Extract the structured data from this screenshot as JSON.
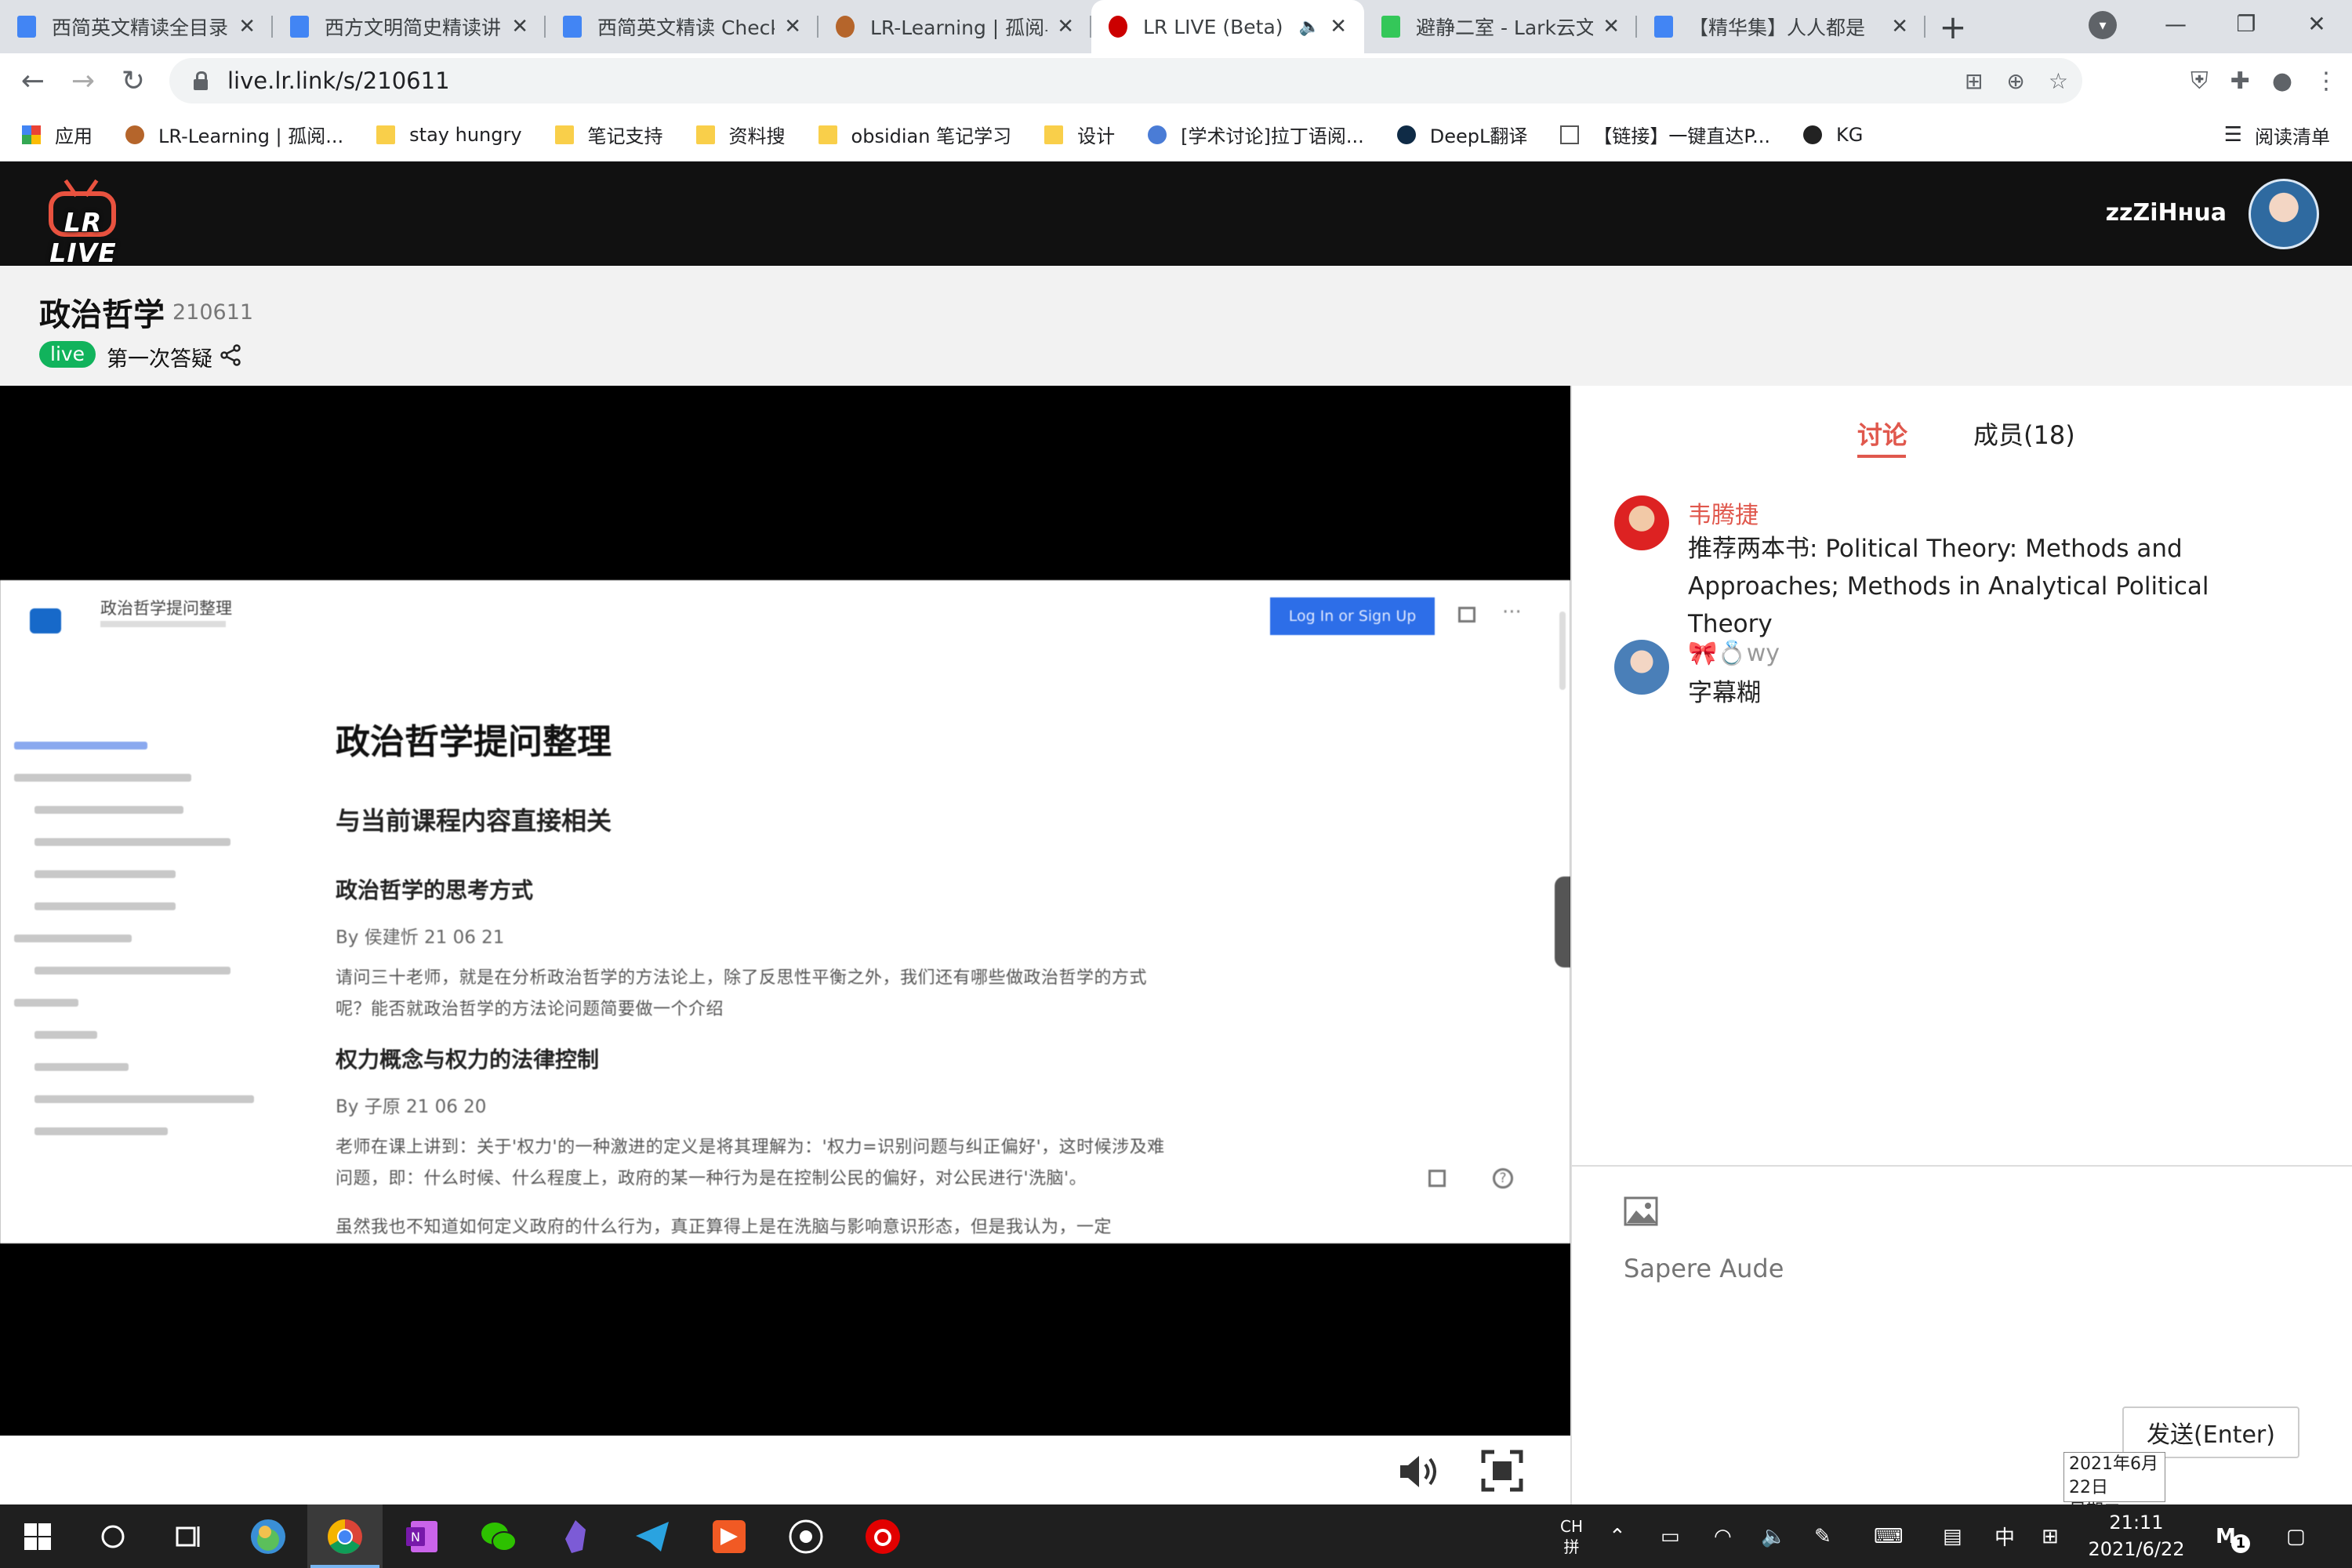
{
  "browser": {
    "tabs": [
      {
        "title": "西简英文精读全目录",
        "icon": "doc",
        "active": false
      },
      {
        "title": "西方文明简史精读讲",
        "icon": "doc",
        "active": false
      },
      {
        "title": "西简英文精读 Check",
        "icon": "doc",
        "active": false
      },
      {
        "title": "LR-Learning | 孤阅与",
        "icon": "lr",
        "active": false
      },
      {
        "title": "LR LIVE (Beta)",
        "icon": "live",
        "active": true
      },
      {
        "title": "避静二室 - Lark云文",
        "icon": "lark",
        "active": false
      },
      {
        "title": "【精华集】人人都是",
        "icon": "doc",
        "active": false
      }
    ],
    "url": "live.lr.link/s/210611",
    "bookmarks": [
      {
        "label": "应用",
        "icon": "apps"
      },
      {
        "label": "LR-Learning | 孤阅...",
        "icon": "lr"
      },
      {
        "label": "stay hungry",
        "icon": "folder"
      },
      {
        "label": "笔记支持",
        "icon": "folder"
      },
      {
        "label": "资料搜",
        "icon": "folder"
      },
      {
        "label": "obsidian 笔记学习",
        "icon": "folder"
      },
      {
        "label": "设计",
        "icon": "folder"
      },
      {
        "label": "[学术讨论]拉丁语阅...",
        "icon": "round"
      },
      {
        "label": "DeepL翻译",
        "icon": "deepl"
      },
      {
        "label": "【链接】一键直达P...",
        "icon": "page"
      },
      {
        "label": "KG",
        "icon": "kg"
      }
    ],
    "reading_list": "阅读清单"
  },
  "site": {
    "logo_text": "LR LIVE",
    "username": "zzZiHнua"
  },
  "room": {
    "title": "政治哲学",
    "id": "210611",
    "live_badge": "live",
    "session": "第一次答疑"
  },
  "slide": {
    "doc_name": "政治哲学提问整理",
    "login_button": "Log In or Sign Up",
    "heading": "政治哲学提问整理",
    "subheading": "与当前课程内容直接相关",
    "sections": [
      {
        "title": "政治哲学的思考方式",
        "by": "By 侯建忻 21 06 21",
        "text": "请问三十老师，就是在分析政治哲学的方法论上，除了反思性平衡之外，我们还有哪些做政治哲学的方式呢？能否就政治哲学的方法论问题简要做一个介绍"
      },
      {
        "title": "权力概念与权力的法律控制",
        "by": "By 子原 21 06 20",
        "text": "老师在课上讲到：关于'权力'的一种激进的定义是将其理解为：'权力=识别问题与纠正偏好'，这时候涉及难问题，即：什么时候、什么程度上，政府的某一种行为是在控制公民的偏好，对公民进行'洗脑'。",
        "text2": "虽然我也不知道如何定义政府的什么行为，真正算得上是在洗脑与影响意识形态，但是我认为，一定"
      }
    ]
  },
  "panel": {
    "tab_discuss": "讨论",
    "tab_members": "成员(18)",
    "messages": [
      {
        "name": "韦腾捷",
        "text": "推荐两本书: Political Theory: Methods and Approaches; Methods in Analytical Political Theory"
      },
      {
        "name_emoji": "🎀💍",
        "name": "wy",
        "text": "字幕糊"
      }
    ],
    "input_placeholder": "Sapere Aude",
    "send_label": "发送(Enter)"
  },
  "taskbar": {
    "ime_top": "CH",
    "ime_bottom": "拼",
    "lang": "中",
    "time": "21:11",
    "date": "2021/6/22",
    "popup_date": "2021年6月22日",
    "popup_weekday": "星期二",
    "notif_count": "1"
  },
  "colors": {
    "accent": "#e0584d",
    "live_green": "#11b35c",
    "header_bg": "#111111",
    "link_blue": "#2d6ee8"
  }
}
